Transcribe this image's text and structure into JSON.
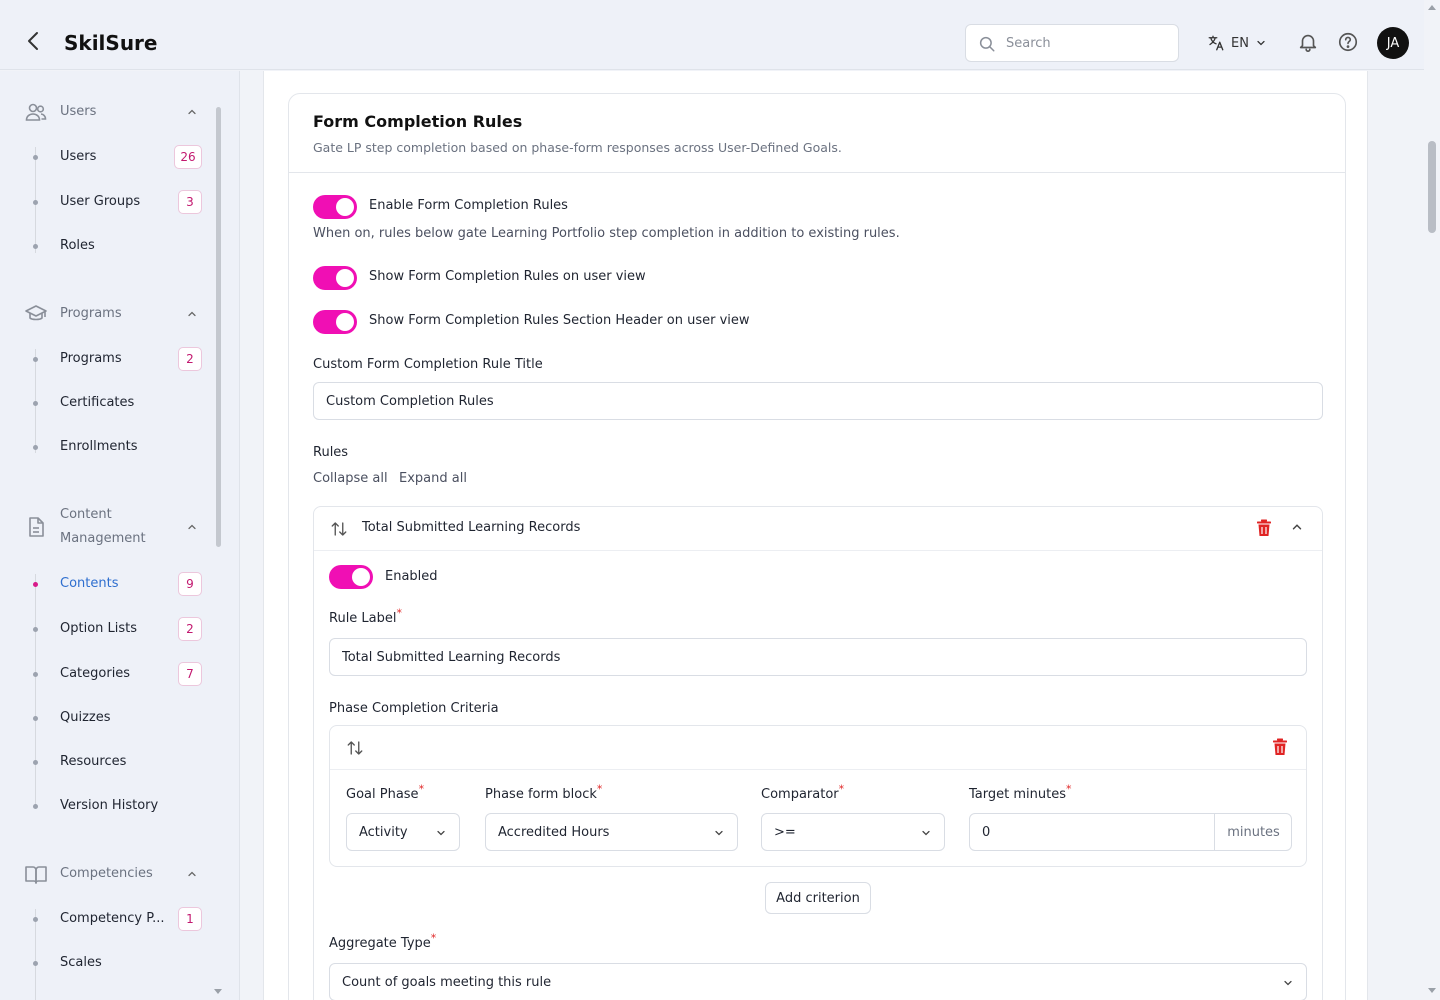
{
  "app": {
    "title": "SkilSure"
  },
  "header": {
    "search_placeholder": "Search",
    "language": "EN",
    "avatar_initials": "JA",
    "icons": [
      "chevron-left-icon",
      "search-icon",
      "translate-icon",
      "chevron-down-icon",
      "bell-icon",
      "help-icon"
    ]
  },
  "sidebar": {
    "groups": [
      {
        "label": "Users",
        "icon": "users-icon",
        "items": [
          {
            "label": "Users",
            "badge": "26"
          },
          {
            "label": "User Groups",
            "badge": "3"
          },
          {
            "label": "Roles",
            "badge": ""
          }
        ]
      },
      {
        "label": "Programs",
        "icon": "graduation-cap-icon",
        "items": [
          {
            "label": "Programs",
            "badge": "2"
          },
          {
            "label": "Certificates",
            "badge": ""
          },
          {
            "label": "Enrollments",
            "badge": ""
          }
        ]
      },
      {
        "label": "Content\nManagement",
        "label_line1": "Content",
        "label_line2": "Management",
        "icon": "document-icon",
        "items": [
          {
            "label": "Contents",
            "badge": "9",
            "active": true
          },
          {
            "label": "Option Lists",
            "badge": "2"
          },
          {
            "label": "Categories",
            "badge": "7"
          },
          {
            "label": "Quizzes",
            "badge": ""
          },
          {
            "label": "Resources",
            "badge": ""
          },
          {
            "label": "Version History",
            "badge": ""
          }
        ]
      },
      {
        "label": "Competencies",
        "icon": "book-open-icon",
        "items": [
          {
            "label": "Competency P...",
            "badge": "1"
          },
          {
            "label": "Scales",
            "badge": ""
          }
        ]
      }
    ],
    "active_color": "#2f6fcf",
    "badge_color": "#c2186f"
  },
  "form": {
    "title": "Form Completion Rules",
    "description": "Gate LP step completion based on phase-form responses across User-Defined Goals.",
    "toggles": {
      "enable": {
        "label": "Enable Form Completion Rules",
        "on": true
      },
      "enable_helper": "When on, rules below gate Learning Portfolio step completion in addition to existing rules.",
      "show_on_user_view": {
        "label": "Show Form Completion Rules on user view",
        "on": true
      },
      "show_header": {
        "label": "Show Form Completion Rules Section Header on user view",
        "on": true
      }
    },
    "custom_title": {
      "label": "Custom Form Completion Rule Title",
      "value": "Custom Completion Rules"
    },
    "rules_label": "Rules",
    "collapse_all": "Collapse all",
    "expand_all": "Expand all",
    "rule": {
      "title": "Total Submitted Learning Records",
      "enabled_label": "Enabled",
      "enabled": true,
      "rule_label": {
        "label": "Rule Label",
        "value": "Total Submitted Learning Records"
      },
      "criteria_label": "Phase Completion Criteria",
      "criterion": {
        "goal_phase": {
          "label": "Goal Phase",
          "value": "Activity"
        },
        "phase_form_block": {
          "label": "Phase form block",
          "value": "Accredited Hours"
        },
        "comparator": {
          "label": "Comparator",
          "value": ">="
        },
        "target_minutes": {
          "label": "Target minutes",
          "value": "0",
          "suffix": "minutes"
        }
      },
      "add_criterion": "Add criterion",
      "aggregate_type": {
        "label": "Aggregate Type",
        "value": "Count of goals meeting this rule"
      }
    },
    "accent_color": "#f00fb4",
    "danger_color": "#e02424"
  }
}
